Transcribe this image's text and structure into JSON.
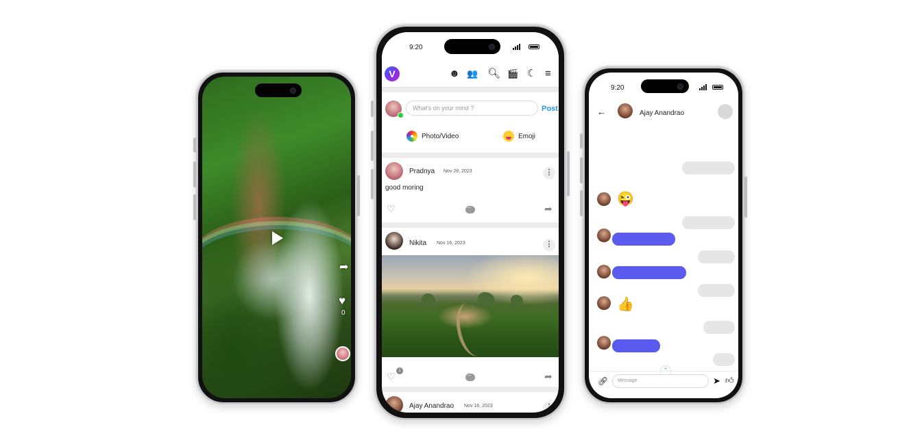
{
  "video_phone": {
    "like_count": "0",
    "icons": [
      "play-icon",
      "share-icon",
      "heart-icon"
    ]
  },
  "feed_phone": {
    "status_time": "9:20",
    "app_logo_letter": "V",
    "nav_icons": [
      "emoji-add-icon",
      "friends-icon",
      "search-icon",
      "reels-icon",
      "dark-mode-icon",
      "menu-icon"
    ],
    "composer": {
      "placeholder": "What's on your mind ?",
      "post_label": "Post",
      "photo_video_label": "Photo/Video",
      "emoji_label": "Emoji"
    },
    "posts": [
      {
        "author": "Pradnya",
        "date": "Nov 28, 2023",
        "text": "good moring"
      },
      {
        "author": "Nikita",
        "date": "Nov 16, 2023",
        "like_badge": "1"
      },
      {
        "author": "Ajay Anandrao",
        "date": "Nov 16, 2023"
      }
    ]
  },
  "chat_phone": {
    "status_time": "9:20",
    "contact_name": "Ajay Anandrao",
    "emoji_messages": [
      "😜",
      "👍"
    ],
    "message_placeholder": "Message",
    "icons": [
      "back-arrow-icon",
      "attach-link-icon",
      "send-icon",
      "thumbs-up-icon",
      "scroll-up-icon"
    ]
  },
  "colors": {
    "accent_blue": "#2196f3",
    "outgoing_bubble": "#5b5bf0",
    "incoming_bubble": "#e6e6e6",
    "online": "#2ecc40"
  }
}
